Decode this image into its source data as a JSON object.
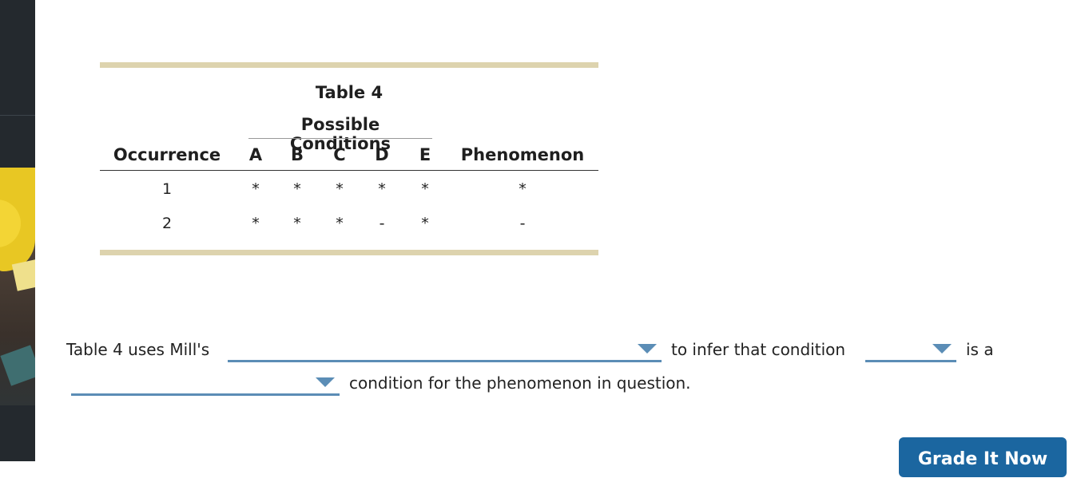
{
  "table": {
    "title": "Table 4",
    "group_header": "Possible Conditions",
    "headers": [
      "Occurrence",
      "A",
      "B",
      "C",
      "D",
      "E",
      "Phenomenon"
    ],
    "rows": [
      [
        "1",
        "*",
        "*",
        "*",
        "*",
        "*",
        "*"
      ],
      [
        "2",
        "*",
        "*",
        "*",
        "-",
        "*",
        "-"
      ]
    ]
  },
  "question": {
    "part1": "Table 4 uses Mill's",
    "part2": "to infer that condition",
    "part3": "is a",
    "part4": "condition for the phenomenon in question.",
    "dropdown_method": "",
    "dropdown_condition": "",
    "dropdown_type": ""
  },
  "grade_button": "Grade It Now",
  "colors": {
    "rule": "#ddd3ae",
    "dropdown": "#5b8db6",
    "button": "#1b66a0",
    "rail": "#24292e"
  }
}
